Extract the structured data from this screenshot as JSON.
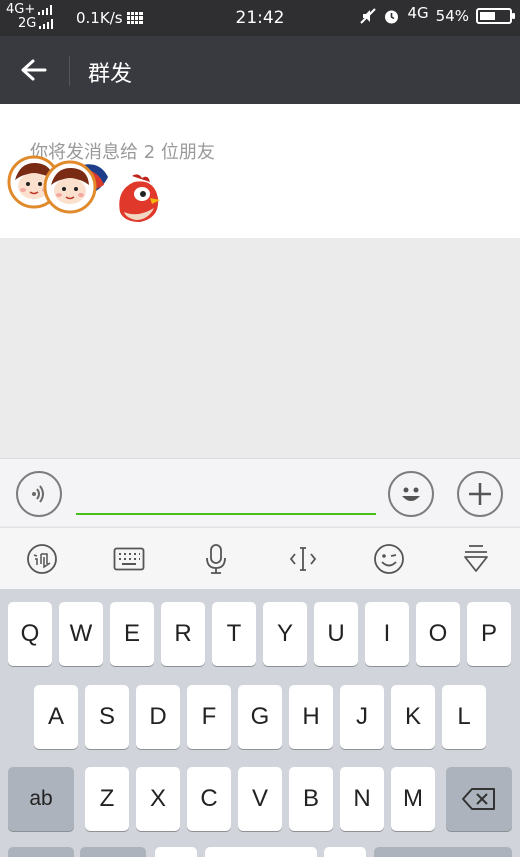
{
  "status_bar": {
    "network_top": "4G+",
    "network_bottom": "2G",
    "speed": "0.1K/s",
    "time": "21:42",
    "network_right": "4G",
    "battery_percent": "54%",
    "battery_level": 0.54
  },
  "header": {
    "back_icon": "back-arrow-icon",
    "title": "群发"
  },
  "recipients": {
    "message": "你将发消息给 2 位朋友",
    "avatars": [
      "boy-cartoon-avatar",
      "boy-cartoon-avatar",
      "red-bird-avatar"
    ]
  },
  "input_bar": {
    "voice_icon": "voice-icon",
    "message_value": "",
    "emoji_icon": "emoji-icon",
    "plus_icon": "plus-icon"
  },
  "keyboard_toolbar": {
    "icons": [
      "handwrite-icon",
      "keyboard-icon",
      "microphone-icon",
      "cursor-icon",
      "emoji-face-icon",
      "hide-keyboard-icon"
    ]
  },
  "keyboard": {
    "row1": [
      "Q",
      "W",
      "E",
      "R",
      "T",
      "Y",
      "U",
      "I",
      "O",
      "P"
    ],
    "row2": [
      "A",
      "S",
      "D",
      "F",
      "G",
      "H",
      "J",
      "K",
      "L"
    ],
    "row3": [
      "Z",
      "X",
      "C",
      "V",
      "B",
      "N",
      "M"
    ],
    "shift_label": "ab",
    "backspace_icon": "backspace-icon"
  },
  "colors": {
    "status_bar": "#2f2f31",
    "title_bar": "#393a3f",
    "input_underline": "#45c01a",
    "keyboard_bg": "#d1d5db"
  }
}
